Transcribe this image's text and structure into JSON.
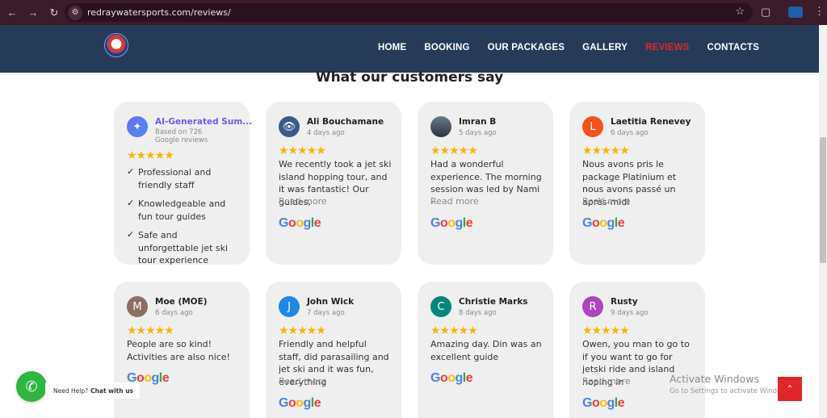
{
  "browser": {
    "url": "redraywatersports.com/reviews/",
    "back_icon": "back-arrow-icon",
    "forward_icon": "forward-arrow-icon",
    "reload_icon": "reload-icon"
  },
  "nav": {
    "items": [
      {
        "label": "HOME"
      },
      {
        "label": "BOOKING"
      },
      {
        "label": "OUR PACKAGES"
      },
      {
        "label": "GALLERY"
      },
      {
        "label": "REVIEWS",
        "active": true
      },
      {
        "label": "CONTACTS"
      }
    ]
  },
  "section": {
    "title": "What our customers say"
  },
  "ai_card": {
    "title": "AI-Generated Sum...",
    "subtitle": "Based on 726 Google reviews",
    "stars": "★★★★★",
    "bullets": [
      "Professional and friendly staff",
      "Knowledgeable and fun tour guides",
      "Safe and unforgettable jet ski tour experience"
    ]
  },
  "reviews": [
    {
      "name": "Ali Bouchamane",
      "ago": "4 days ago",
      "initial": "",
      "color": "#3b5a8a",
      "stars": "★★★★★",
      "text": "We recently took a jet ski island hopping tour, and it was fantastic! Our guides,",
      "read_more": "Read more"
    },
    {
      "name": "Imran B",
      "ago": "5 days ago",
      "initial": "",
      "color": "#4a5566",
      "stars": "★★★★★",
      "text": "Had a wonderful experience. The morning session was led by Nami -",
      "read_more": "Read more"
    },
    {
      "name": "Laetitia Renevey",
      "ago": "6 days ago",
      "initial": "L",
      "color": "#f4511e",
      "stars": "★★★★★",
      "text": "Nous avons pris le package Platinium et nous avons passé un après-midi",
      "read_more": "Read more"
    },
    {
      "name": "Moe (MOE)",
      "ago": "6 days ago",
      "initial": "M",
      "color": "#8d6e63",
      "stars": "★★★★★",
      "text": "People are so kind! Activities are also nice!",
      "read_more": ""
    },
    {
      "name": "John Wick",
      "ago": "7 days ago",
      "initial": "J",
      "color": "#1e88e5",
      "stars": "★★★★★",
      "text": "Friendly and helpful staff, did parasailing and jet ski and it was fun, everything",
      "read_more": "Read more"
    },
    {
      "name": "Christie Marks",
      "ago": "8 days ago",
      "initial": "C",
      "color": "#00897b",
      "stars": "★★★★★",
      "text": "Amazing day. Din was an excellent guide",
      "read_more": ""
    },
    {
      "name": "Rusty",
      "ago": "9 days ago",
      "initial": "R",
      "color": "#ab47bc",
      "stars": "★★★★★",
      "text": "Owen, you man to go to if you want to go for jetski ride and island hoping in",
      "read_more": "Read more"
    }
  ],
  "whatsapp": {
    "label_prefix": "Need Help?",
    "label_bold": "Chat with us"
  },
  "watermark": {
    "line1": "Activate Windows",
    "line2": "Go to Settings to activate Windows."
  },
  "google_logo": "Google"
}
